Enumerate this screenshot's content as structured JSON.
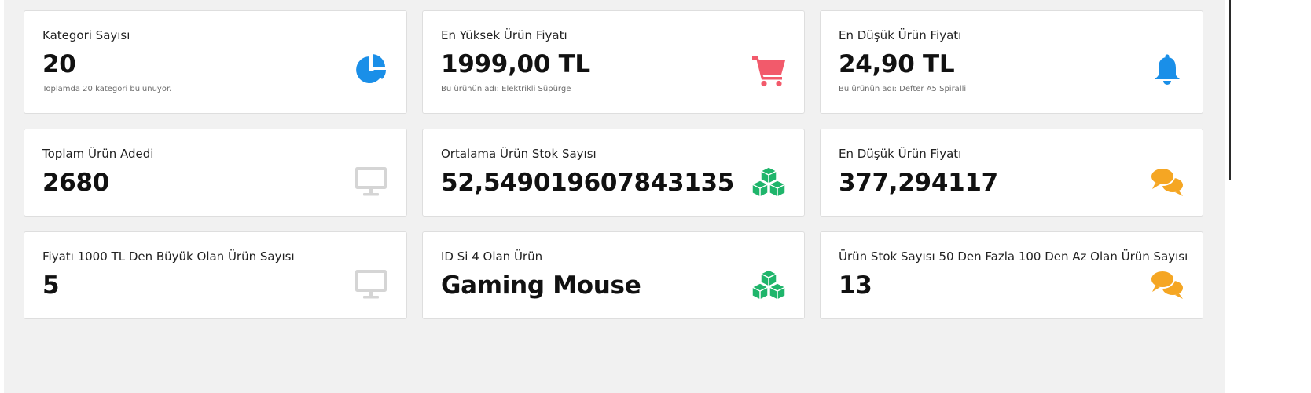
{
  "colors": {
    "blue": "#1a8fe8",
    "red": "#f25a6b",
    "green": "#1fb56b",
    "orange": "#f5a623",
    "gray": "#d5d5d5"
  },
  "cards": [
    {
      "title": "Kategori Sayısı",
      "value": "20",
      "subtitle": "Toplamda 20 kategori bulunuyor.",
      "icon": "pie-chart-icon"
    },
    {
      "title": "En Yüksek Ürün Fiyatı",
      "value": "1999,00 TL",
      "subtitle": "Bu ürünün adı: Elektrikli Süpürge",
      "icon": "shopping-cart-icon"
    },
    {
      "title": "En Düşük Ürün Fiyatı",
      "value": "24,90 TL",
      "subtitle": "Bu ürünün adı: Defter A5 Spiralli",
      "icon": "bell-icon"
    },
    {
      "title": "Toplam Ürün Adedi",
      "value": "2680",
      "icon": "monitor-icon"
    },
    {
      "title": "Ortalama Ürün Stok Sayısı",
      "value": "52,549019607843135",
      "icon": "cubes-icon"
    },
    {
      "title": "En Düşük Ürün Fiyatı",
      "value": "377,294117",
      "icon": "comments-icon"
    },
    {
      "title": "Fiyatı 1000 TL Den Büyük Olan Ürün Sayısı",
      "value": "5",
      "icon": "monitor-icon"
    },
    {
      "title": "ID Si 4 Olan Ürün",
      "value": "Gaming Mouse",
      "icon": "cubes-icon"
    },
    {
      "title": "Ürün Stok Sayısı 50 Den Fazla 100 Den Az Olan Ürün Sayısı",
      "value": "13",
      "icon": "comments-icon"
    }
  ]
}
